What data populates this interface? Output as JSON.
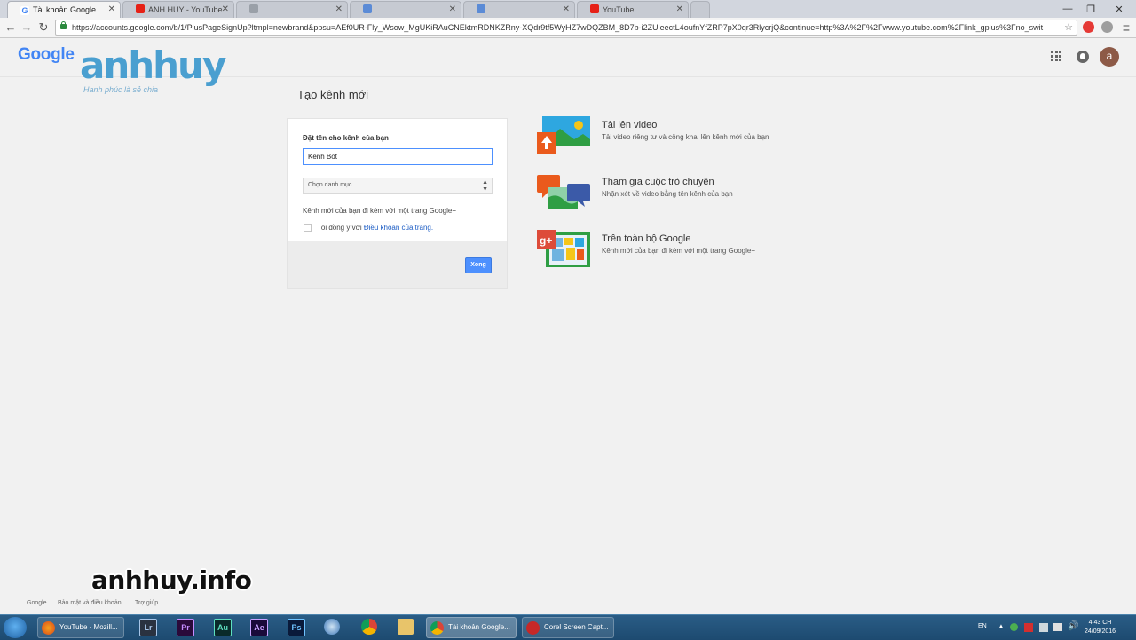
{
  "browser": {
    "tabs": [
      {
        "label": "Tài khoản Google",
        "active": true,
        "favicon_color": "#4285f4"
      },
      {
        "label": "ANH HUY - YouTube",
        "active": false,
        "favicon_color": "#e62117"
      },
      {
        "label": "",
        "active": false,
        "favicon_color": "#9aa0a8"
      },
      {
        "label": "",
        "active": false,
        "favicon_color": "#5b8bd6"
      },
      {
        "label": "",
        "active": false,
        "favicon_color": "#5b8bd6"
      },
      {
        "label": "YouTube",
        "active": false,
        "favicon_color": "#e62117"
      }
    ],
    "url": "https://accounts.google.com/b/1/PlusPageSignUp?ltmpl=newbrand&ppsu=AEf0UR-Fly_Wsow_MgUKiRAuCNEktmRDNKZRny-XQdr9tf5WyHZ7wDQZBM_8D7b-i2ZUleectL4oufnYfZRP7pX0qr3RlycrjQ&continue=http%3A%2F%2Fwww.youtube.com%2Flink_gplus%3Fno_swit"
  },
  "header": {
    "logo_text": "Google",
    "watermark_text": "anhhuy",
    "watermark_sub": "Hạnh phúc là sẻ chia",
    "avatar_letter": "a"
  },
  "main": {
    "title": "Tạo kênh mới",
    "form": {
      "name_label": "Đặt tên cho kênh của bạn",
      "name_value": "Kênh Bot",
      "category_placeholder": "Chọn danh mục",
      "note": "Kênh mới của bạn đi kèm với một trang Google+",
      "agree_prefix": "Tôi đồng ý với ",
      "agree_link": "Điều khoản của trang.",
      "done_button": "Xong"
    },
    "features": [
      {
        "title": "Tải lên video",
        "desc": "Tải video riêng tư và công khai lên kênh mới của bạn",
        "icon": "upload-video-icon"
      },
      {
        "title": "Tham gia cuộc trò chuyện",
        "desc": "Nhận xét về video bằng tên kênh của bạn",
        "icon": "conversation-icon"
      },
      {
        "title": "Trên toàn bộ Google",
        "desc": "Kênh mới của bạn đi kèm với một trang Google+",
        "icon": "google-plus-page-icon"
      }
    ]
  },
  "footer": {
    "links": [
      "Google",
      "Bảo mật và điều khoản",
      "Trợ giúp"
    ],
    "site_watermark": "anhhuy.info"
  },
  "taskbar": {
    "firefox_label": "YouTube - Mozill...",
    "pinned": [
      "Lr",
      "Pr",
      "Au",
      "Ae",
      "Ps"
    ],
    "chrome_label": "Tài khoản Google...",
    "corel_label": "Corel Screen Capt...",
    "lang": "EN",
    "time": "4:43 CH",
    "date": "24/09/2016"
  },
  "colors": {
    "accent_blue": "#4d90fe",
    "link_blue": "#1a5bc4",
    "watermark_blue": "#4a9fd0",
    "taskbar": "#1d4a70"
  }
}
